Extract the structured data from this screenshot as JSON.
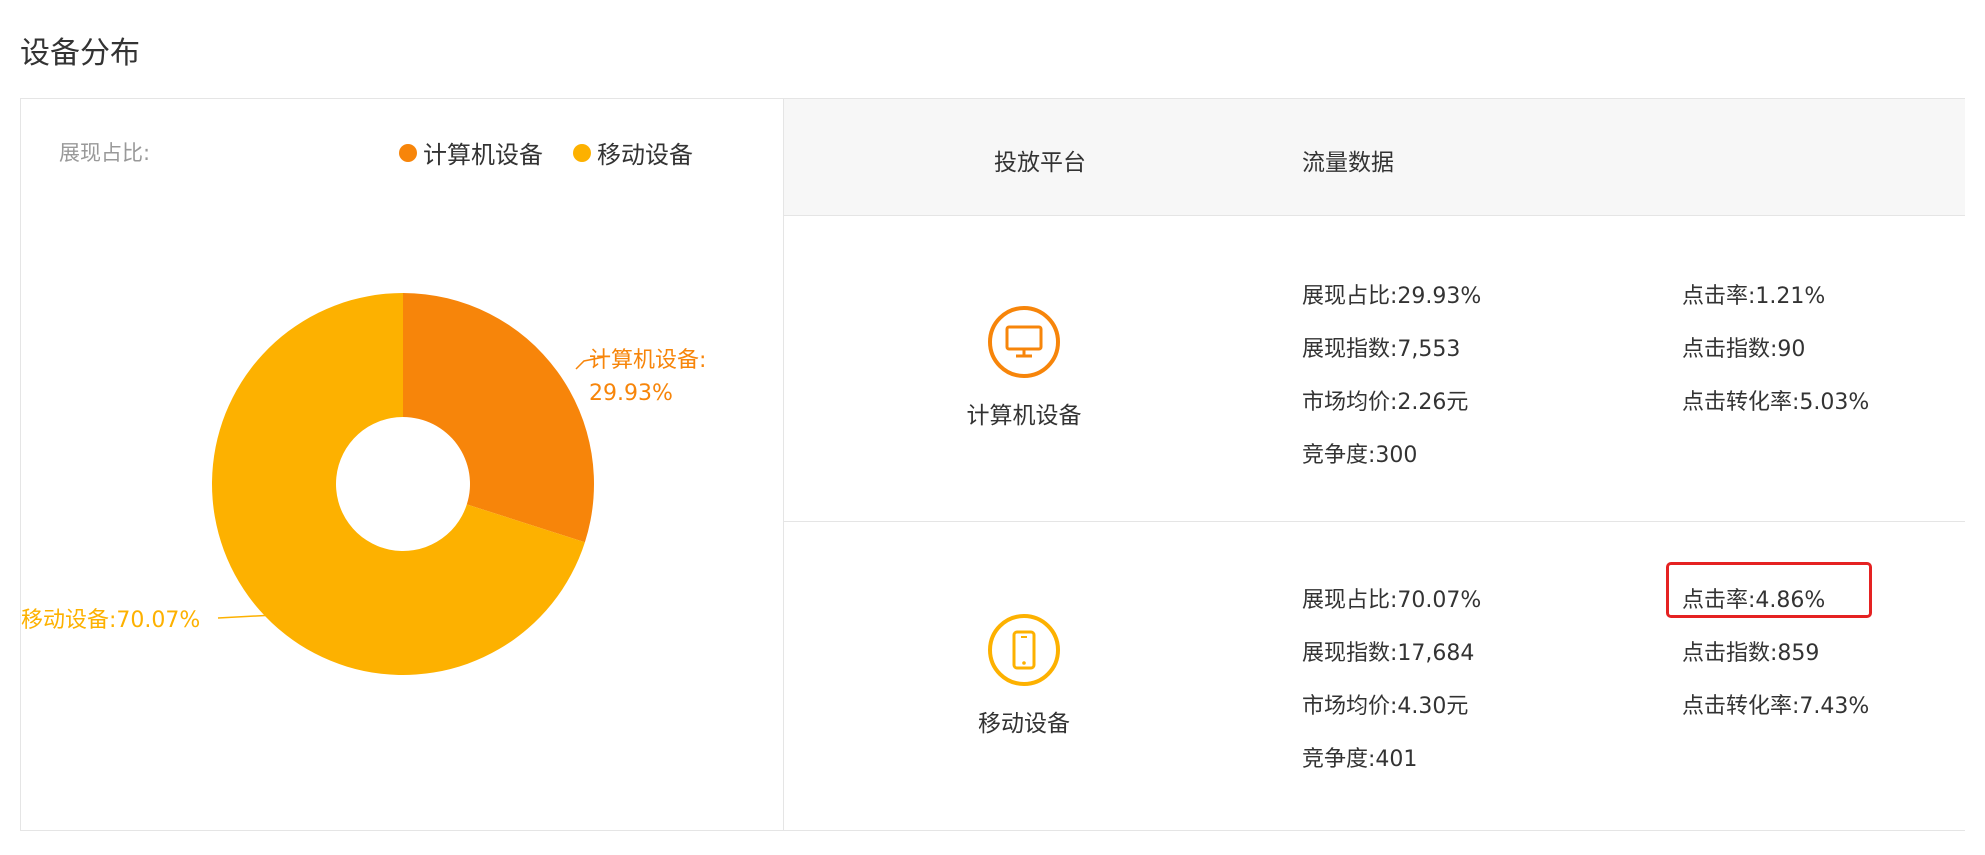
{
  "page_title": "设备分布",
  "chart": {
    "ratio_label": "展现占比:",
    "legend": [
      {
        "label": "计算机设备",
        "color": "#f7850a"
      },
      {
        "label": "移动设备",
        "color": "#fdb100"
      }
    ],
    "slice_labels": {
      "pc_line1": "计算机设备:",
      "pc_line2": "29.93%",
      "mobile": "移动设备:70.07%"
    }
  },
  "chart_data": {
    "type": "pie",
    "donut": true,
    "categories": [
      "计算机设备",
      "移动设备"
    ],
    "values": [
      29.93,
      70.07
    ],
    "colors": [
      "#f7850a",
      "#fdb100"
    ],
    "legend_position": "top-right"
  },
  "table": {
    "headers": [
      "投放平台",
      "流量数据"
    ],
    "rows": [
      {
        "platform": "计算机设备",
        "icon": "monitor-icon",
        "icon_color": "#f7850a",
        "left_stats": [
          "展现占比:29.93%",
          "展现指数:7,553",
          "市场均价:2.26元",
          "竞争度:300"
        ],
        "right_stats": [
          "点击率:1.21%",
          "点击指数:90",
          "点击转化率:5.03%"
        ]
      },
      {
        "platform": "移动设备",
        "icon": "smartphone-icon",
        "icon_color": "#fdb100",
        "left_stats": [
          "展现占比:70.07%",
          "展现指数:17,684",
          "市场均价:4.30元",
          "竞争度:401"
        ],
        "right_stats": [
          "点击率:4.86%",
          "点击指数:859",
          "点击转化率:7.43%"
        ]
      }
    ]
  },
  "highlight_color": "#e52222"
}
